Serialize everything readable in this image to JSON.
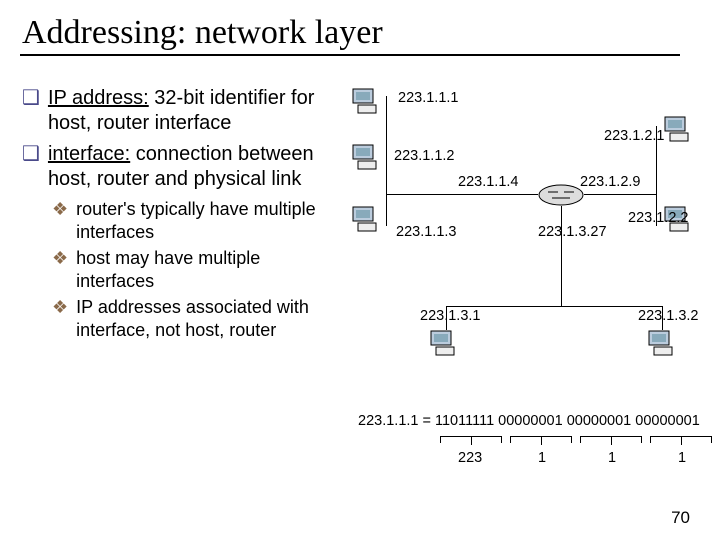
{
  "title": "Addressing: network layer",
  "bullets_l1": [
    {
      "term": "IP address:",
      "rest": " 32-bit identifier for host, router interface"
    },
    {
      "term": "interface:",
      "rest": " connection between host, router and physical link"
    }
  ],
  "bullets_l2": [
    "router's typically have multiple interfaces",
    "host may have multiple interfaces",
    "IP addresses associated with interface, not host, router"
  ],
  "ips": {
    "h1": "223.1.1.1",
    "h2": "223.1.1.2",
    "h3": "223.1.1.3",
    "r1": "223.1.1.4",
    "r2": "223.1.2.9",
    "h4": "223.1.2.1",
    "h5": "223.1.2.2",
    "r3": "223.1.3.27",
    "h6": "223.1.3.1",
    "h7": "223.1.3.2"
  },
  "binary": {
    "lhs": "223.1.1.1 = ",
    "oct1": "11011111",
    "oct2": "00000001",
    "oct3": "00000001",
    "oct4": "00000001"
  },
  "decimals": {
    "d1": "223",
    "d2": "1",
    "d3": "1",
    "d4": "1"
  },
  "page_number": "70"
}
